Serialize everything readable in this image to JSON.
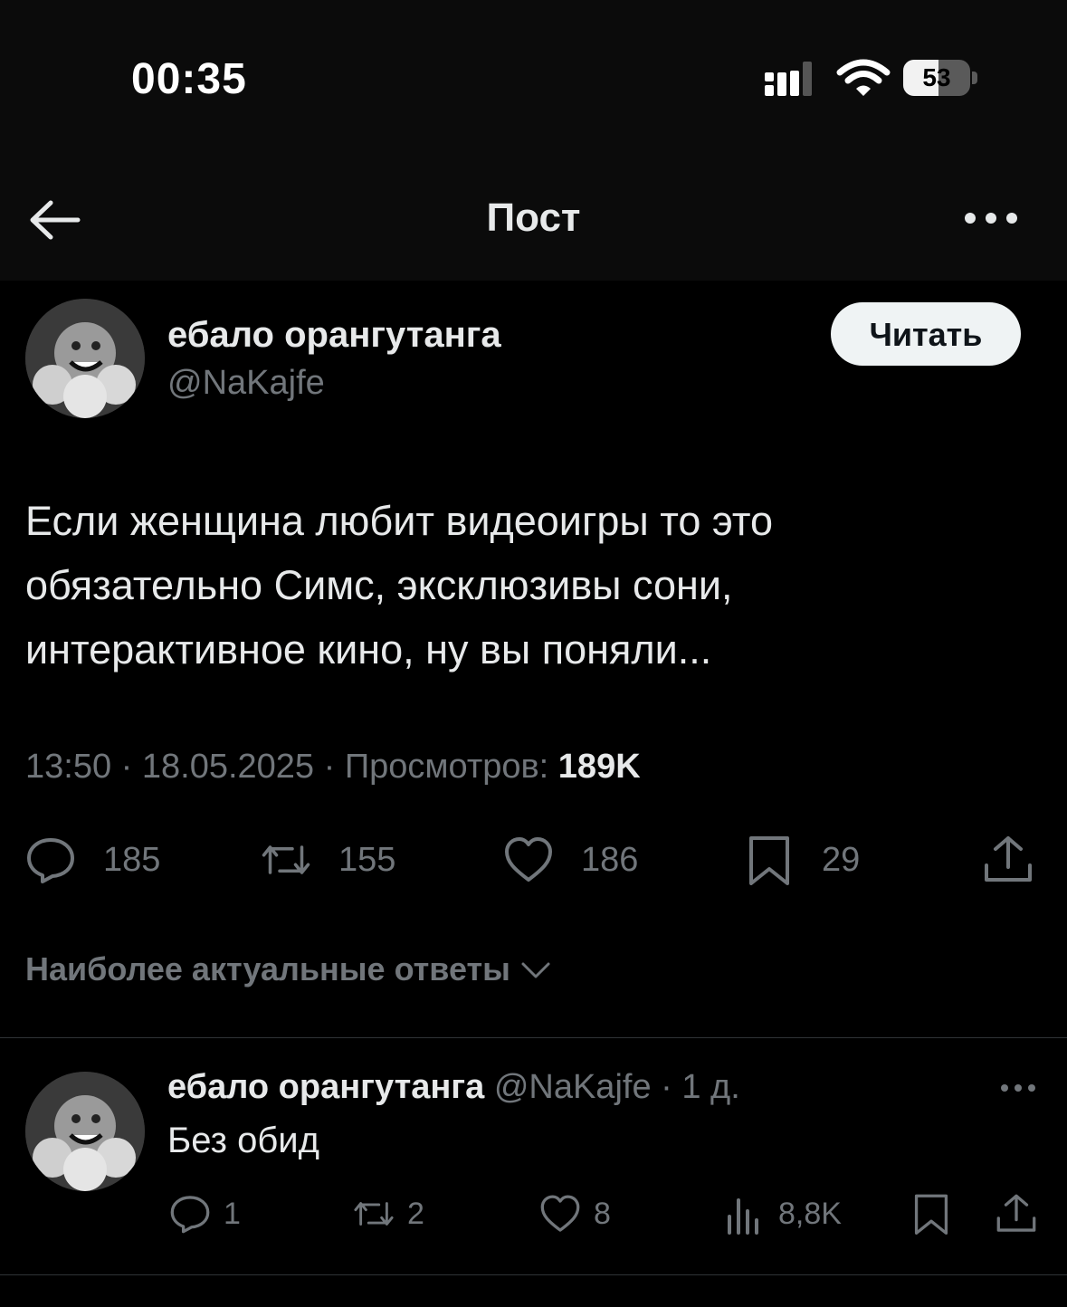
{
  "status_bar": {
    "time": "00:35",
    "battery_level": "53"
  },
  "nav": {
    "title": "Пост"
  },
  "post": {
    "author_name": "ебало орангутанга",
    "author_handle": "@NaKajfe",
    "follow_label": "Читать",
    "text_lines": [
      "Если женщина любит видеоигры то это",
      "обязательно Симс, эксклюзивы сони,",
      "интерактивное кино, ну вы поняли..."
    ],
    "meta_time": "13:50 · 18.05.2025 · Просмотров: ",
    "meta_views": "189K",
    "counts": {
      "replies": "185",
      "reposts": "155",
      "likes": "186",
      "bookmarks": "29"
    }
  },
  "replies_sort_label": "Наиболее актуальные ответы",
  "reply": {
    "author_name": "ебало орангутанга",
    "author_handle": "@NaKajfe",
    "separator": "·",
    "age": "1 д.",
    "text": "Без обид",
    "counts": {
      "replies": "1",
      "reposts": "2",
      "likes": "8",
      "views": "8,8K"
    }
  }
}
